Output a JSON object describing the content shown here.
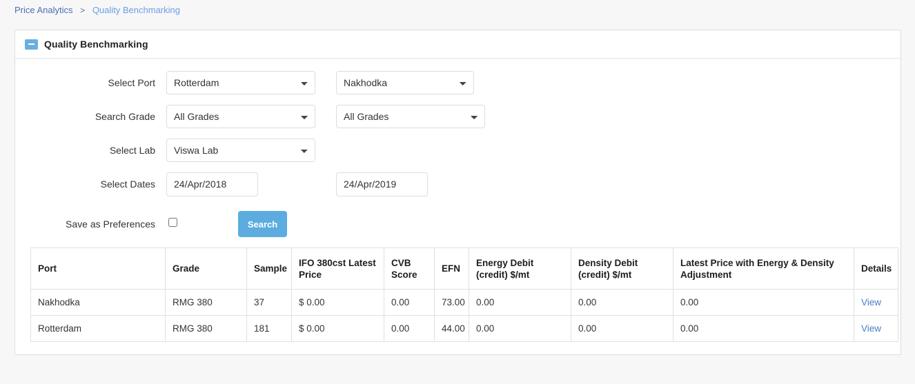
{
  "breadcrumb": {
    "parent": "Price Analytics",
    "separator": ">",
    "current": "Quality Benchmarking"
  },
  "panel": {
    "title": "Quality Benchmarking",
    "collapse_icon": "minus-square-icon"
  },
  "form": {
    "rows": [
      {
        "label": "Select Port",
        "field_a": {
          "type": "select",
          "value": "Rotterdam",
          "icon": "chevron-down-icon"
        },
        "field_b": {
          "type": "select",
          "value": "Nakhodka",
          "icon": "chevron-down-icon"
        }
      },
      {
        "label": "Search Grade",
        "field_a": {
          "type": "select",
          "value": "All Grades",
          "icon": "chevron-down-icon"
        },
        "field_b": {
          "type": "select",
          "value": "All Grades",
          "icon": "chevron-down-icon"
        }
      },
      {
        "label": "Select Lab",
        "field_a": {
          "type": "select",
          "value": "Viswa Lab",
          "icon": "chevron-down-icon"
        },
        "field_b": null
      },
      {
        "label": "Select Dates",
        "field_a": {
          "type": "date",
          "value": "24/Apr/2018"
        },
        "field_b": {
          "type": "date",
          "value": "24/Apr/2019"
        }
      }
    ],
    "preferences": {
      "label": "Save as Preferences",
      "checked": false
    },
    "search_button": "Search"
  },
  "table": {
    "columns": [
      "Port",
      "Grade",
      "Sample",
      "IFO 380cst Latest Price",
      "CVB Score",
      "EFN",
      "Energy Debit (credit) $/mt",
      "Density Debit (credit) $/mt",
      "Latest Price with Energy & Density Adjustment",
      "Details"
    ],
    "rows": [
      {
        "port": "Nakhodka",
        "grade": "RMG 380",
        "sample": "37",
        "price": "$ 0.00",
        "cvb": "0.00",
        "efn": "73.00",
        "energy": "0.00",
        "density": "0.00",
        "latest": "0.00",
        "details": "View"
      },
      {
        "port": "Rotterdam",
        "grade": "RMG 380",
        "sample": "181",
        "price": "$ 0.00",
        "cvb": "0.00",
        "efn": "44.00",
        "energy": "0.00",
        "density": "0.00",
        "latest": "0.00",
        "details": "View"
      }
    ]
  },
  "colors": {
    "accent": "#5cace0",
    "link": "#4a6fb5",
    "link_light": "#6b9ee8",
    "page_bg": "#f7f7f7",
    "border": "#dddddd"
  }
}
